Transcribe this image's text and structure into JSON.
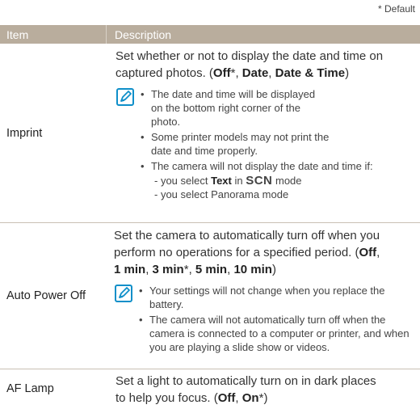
{
  "default_note": "* Default",
  "header": {
    "item": "Item",
    "description": "Description"
  },
  "rows": [
    {
      "item": "Imprint",
      "desc_line1": "Set whether or not to display the date and time on",
      "desc_line2_a": "captured photos. (",
      "opt_off": "Off",
      "star1": "*",
      "sep1": ", ",
      "opt_date": "Date",
      "sep2": ", ",
      "opt_date_time": "Date & Time",
      "close": ")",
      "notes": [
        "The date and time will be displayed on the bottom right corner of the photo.",
        "Some printer models may not print the date and time properly.",
        "The camera will not display the date and time if:"
      ],
      "sub1_a": "- you select ",
      "sub1_text": "Text",
      "sub1_b": " in ",
      "sub1_scn": "SCN",
      "sub1_c": " mode",
      "sub2": "- you select Panorama mode"
    },
    {
      "item": "Auto Power Off",
      "desc_line1": "Set the camera to automatically turn off when you",
      "desc_line2_a": "perform no operations for a specified period. (",
      "opt_off": "Off",
      "sep0": ",",
      "opt_1": "1 min",
      "sep1": ", ",
      "opt_3": "3 min",
      "star": "*",
      "sep2": ", ",
      "opt_5": "5 min",
      "sep3": ", ",
      "opt_10": "10 min",
      "close": ")",
      "notes": [
        "Your settings will not change when you replace the battery.",
        "The camera will not automatically turn off when the camera is connected to a computer or printer, and when you are playing a slide show or videos."
      ]
    },
    {
      "item": "AF Lamp",
      "desc_line1": "Set a light to automatically turn on in dark places",
      "desc_line2_a": "to help you focus. (",
      "opt_off": "Off",
      "sep": ", ",
      "opt_on": "On",
      "star": "*",
      "close": ")"
    }
  ],
  "colors": {
    "header_bg": "#b9ad9d",
    "note_icon": "#0f8fc9"
  }
}
